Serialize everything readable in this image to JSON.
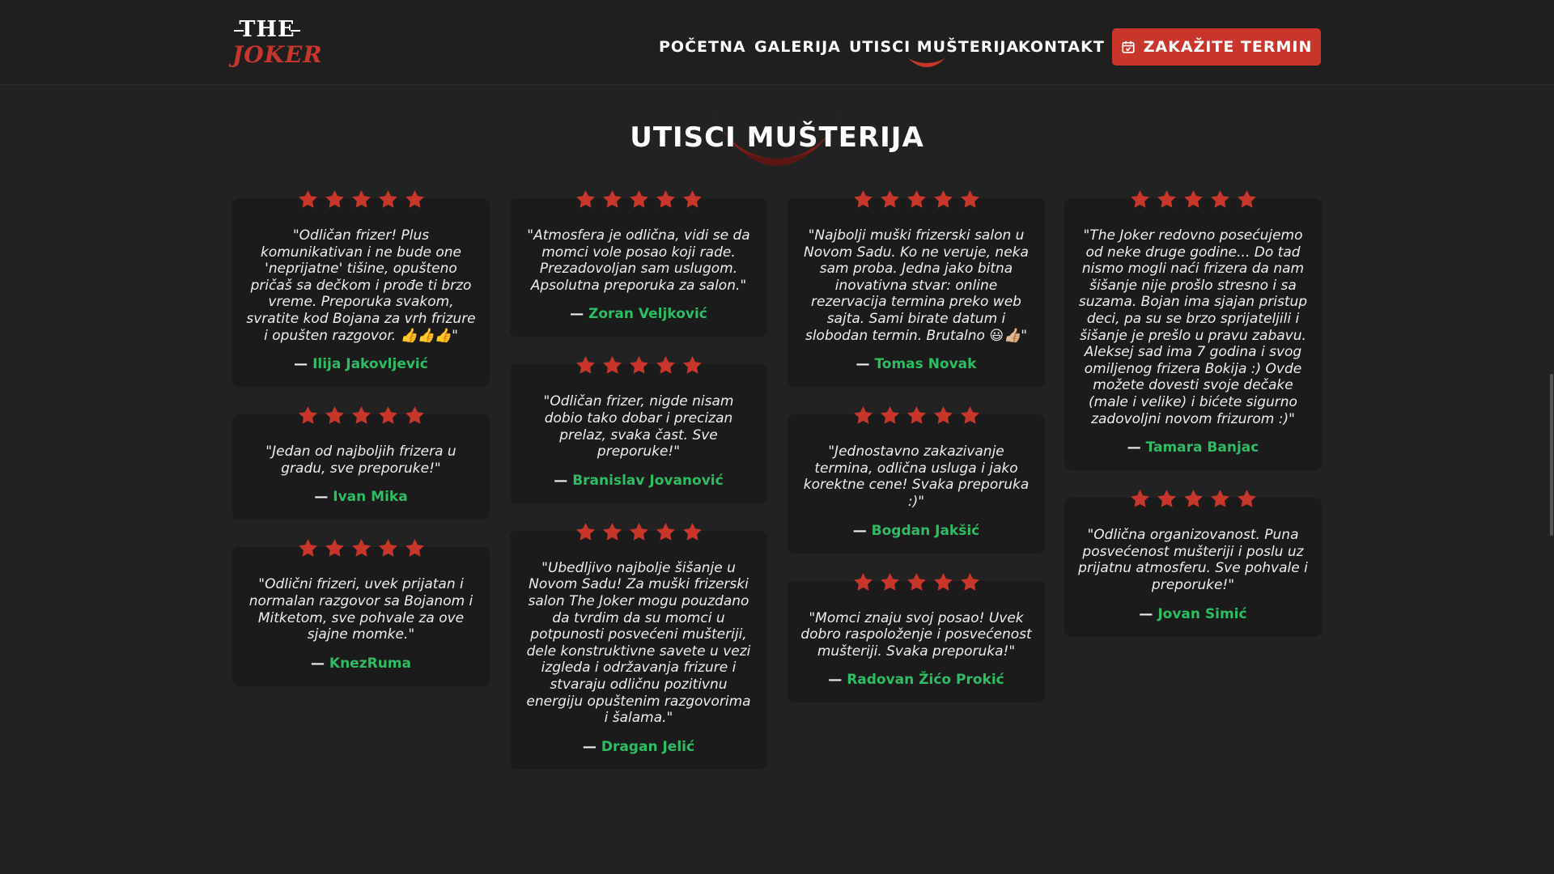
{
  "brand": {
    "line1": "THE",
    "line2": "JOKER"
  },
  "nav": [
    {
      "label": "POČETNA"
    },
    {
      "label": "GALERIJA"
    },
    {
      "label": "UTISCI MUŠTERIJA"
    },
    {
      "label": "KONTAKT"
    }
  ],
  "active_nav": "UTISCI MUŠTERIJA",
  "cta_label": "ZAKAŽITE TERMIN",
  "section_title": "UTISCI MUŠTERIJA",
  "colors": {
    "accent": "#c8362b",
    "name": "#2ebd63",
    "card": "#1b1b1b",
    "bg": "#222222"
  },
  "rating_max": 5,
  "columns": [
    [
      {
        "rating": 5,
        "quote": "\"Odličan frizer! Plus komunikativan i ne bude one 'neprijatne' tišine, opušteno pričaš sa dečkom i prođe ti brzo vreme. Preporuka svakom, svratite kod Bojana za vrh frizure i opušten razgovor. 👍👍👍\"",
        "author": "Ilija Jakovljević"
      },
      {
        "rating": 5,
        "quote": "\"Jedan od najboljih frizera u gradu, sve preporuke!\"",
        "author": "Ivan Mika"
      },
      {
        "rating": 5,
        "quote": "\"Odlični frizeri, uvek prijatan i normalan razgovor sa Bojanom i Mitketom, sve pohvale za ove sjajne momke.\"",
        "author": "KnezRuma"
      }
    ],
    [
      {
        "rating": 5,
        "quote": "\"Atmosfera je odlična, vidi se da momci vole posao koji rade. Prezadovoljan sam uslugom. Apsolutna preporuka za salon.\"",
        "author": "Zoran Veljković"
      },
      {
        "rating": 5,
        "quote": "\"Odličan frizer, nigde nisam dobio tako dobar i precizan prelaz, svaka čast. Sve preporuke!\"",
        "author": "Branislav Jovanović"
      },
      {
        "rating": 5,
        "quote": "\"Ubedljivo najbolje šišanje u Novom Sadu! Za muški frizerski salon The Joker mogu pouzdano da tvrdim da su momci u potpunosti posvećeni mušteriji, dele konstruktivne savete u vezi izgleda i održavanja frizure i stvaraju odličnu pozitivnu energiju opuštenim razgovorima i šalama.\"",
        "author": "Dragan Jelić"
      }
    ],
    [
      {
        "rating": 5,
        "quote": "\"Najbolji muški frizerski salon u Novom Sadu. Ko ne veruje, neka sam proba. Jedna jako bitna inovativna stvar: online rezervacija termina preko web sajta. Sami birate datum i slobodan termin. Brutalno 😃👍🏼\"",
        "author": "Tomas Novak"
      },
      {
        "rating": 5,
        "quote": "\"Jednostavno zakazivanje termina, odlična usluga i jako korektne cene! Svaka preporuka :)\"",
        "author": "Bogdan Jakšić"
      },
      {
        "rating": 5,
        "quote": "\"Momci znaju svoj posao! Uvek dobro raspoloženje i posvećenost mušteriji. Svaka preporuka!\"",
        "author": "Radovan Žićo Prokić"
      }
    ],
    [
      {
        "rating": 5,
        "quote": "\"The Joker redovno posećujemo od neke druge godine... Do tad nismo mogli naći frizera da nam šišanje nije prošlo stresno i sa suzama. Bojan ima sjajan pristup deci, pa su se brzo sprijateljili i šišanje je prešlo u pravu zabavu. Aleksej sad ima 7 godina i svog omiljenog frizera Bokija :) Ovde možete dovesti svoje dečake (male i velike) i bićete sigurno zadovoljni novom frizurom :)\"",
        "author": "Tamara Banjac"
      },
      {
        "rating": 5,
        "quote": "\"Odlična organizovanost. Puna posvećenost mušteriji i poslu uz prijatnu atmosferu. Sve pohvale i preporuke!\"",
        "author": "Jovan Simić"
      }
    ]
  ]
}
